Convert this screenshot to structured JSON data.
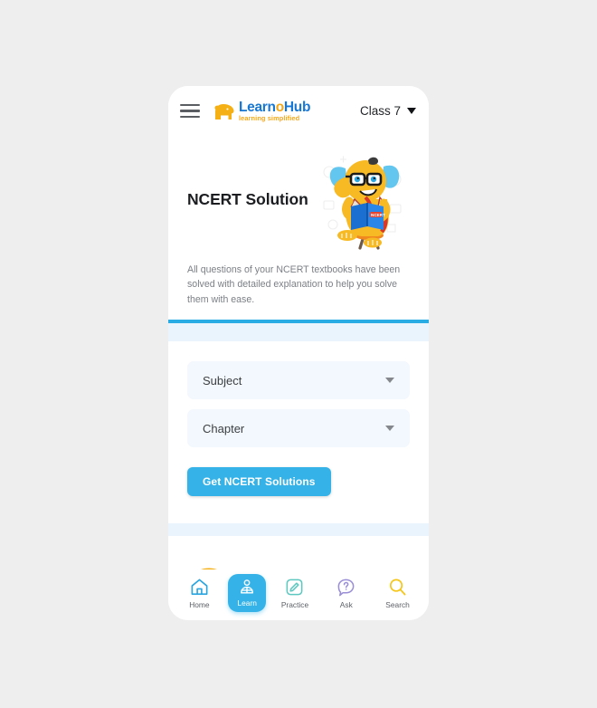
{
  "header": {
    "menu_icon": "hamburger-menu-icon",
    "brand": {
      "mark_icon": "elephant-logo-icon",
      "word_part1": "Learn",
      "word_accent": "o",
      "word_part2": "Hub",
      "tagline": "learning simplified"
    },
    "class_selector": {
      "label": "Class 7",
      "caret_icon": "chevron-down-icon"
    }
  },
  "hero": {
    "title": "NCERT Solution",
    "mascot_icon": "elephant-reading-book-mascot",
    "description": "All questions of your NCERT textbooks have been solved with detailed explanation to help you solve them with ease."
  },
  "form": {
    "fields": [
      {
        "label": "Subject",
        "caret_icon": "chevron-down-icon"
      },
      {
        "label": "Chapter",
        "caret_icon": "chevron-down-icon"
      }
    ],
    "submit_label": "Get NCERT Solutions"
  },
  "next_card": {
    "mascot_icon": "elephant-partial-icon"
  },
  "bottom_nav": {
    "items": [
      {
        "label": "Home",
        "icon": "home-icon",
        "active": false
      },
      {
        "label": "Learn",
        "icon": "learn-icon",
        "active": true
      },
      {
        "label": "Practice",
        "icon": "practice-icon",
        "active": false
      },
      {
        "label": "Ask",
        "icon": "ask-icon",
        "active": false
      },
      {
        "label": "Search",
        "icon": "search-icon",
        "active": false
      }
    ]
  },
  "colors": {
    "accent_blue": "#35b3e8",
    "brand_blue": "#1877d2",
    "brand_orange": "#f5a816",
    "page_background": "#eeeeee",
    "scroll_background": "#e9f4fc",
    "field_background": "#f2f8fd",
    "practice_green": "#5ec8c0",
    "ask_purple": "#9a8ed6",
    "search_yellow": "#f5c518"
  }
}
